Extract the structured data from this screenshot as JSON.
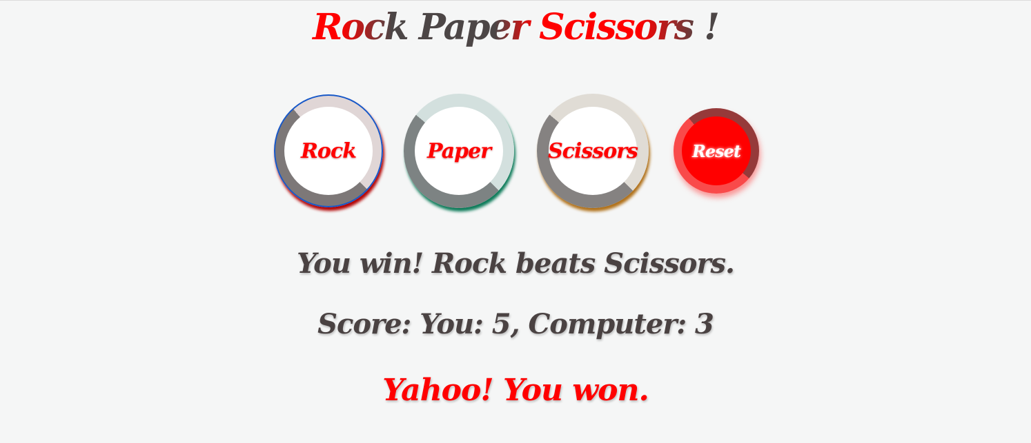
{
  "title": "Rock Paper Scissors !",
  "choices": {
    "rock": "Rock",
    "paper": "Paper",
    "scissors": "Scissors",
    "reset": "Reset"
  },
  "result_text": "You win! Rock beats Scissors.",
  "score_text": "Score: You: 5, Computer: 3",
  "final_text": "Yahoo! You won.",
  "colors": {
    "accent": "#ff0000",
    "text": "#4a4242",
    "background": "#f5f6f6"
  }
}
